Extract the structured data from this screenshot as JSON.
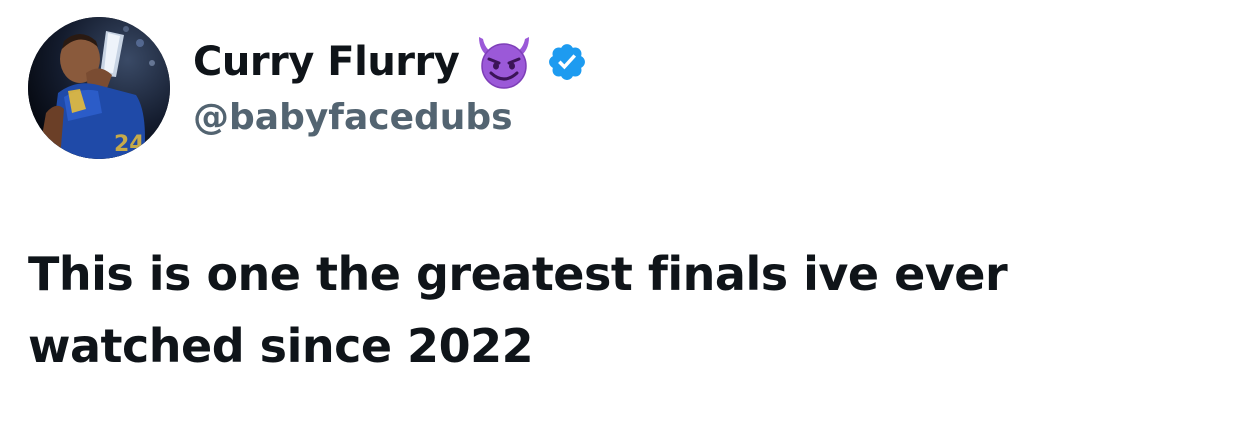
{
  "user": {
    "display_name": "Curry Flurry",
    "handle": "@babyfacedubs",
    "emoji_icon": "smiling-devil-icon",
    "verified_icon": "verified-badge-icon",
    "verified_color": "#1d9bf0"
  },
  "tweet": {
    "text": "This is one the greatest finals ive ever watched since 2022"
  },
  "colors": {
    "text_primary": "#0f1419",
    "text_secondary": "#536471",
    "background": "#ffffff"
  }
}
